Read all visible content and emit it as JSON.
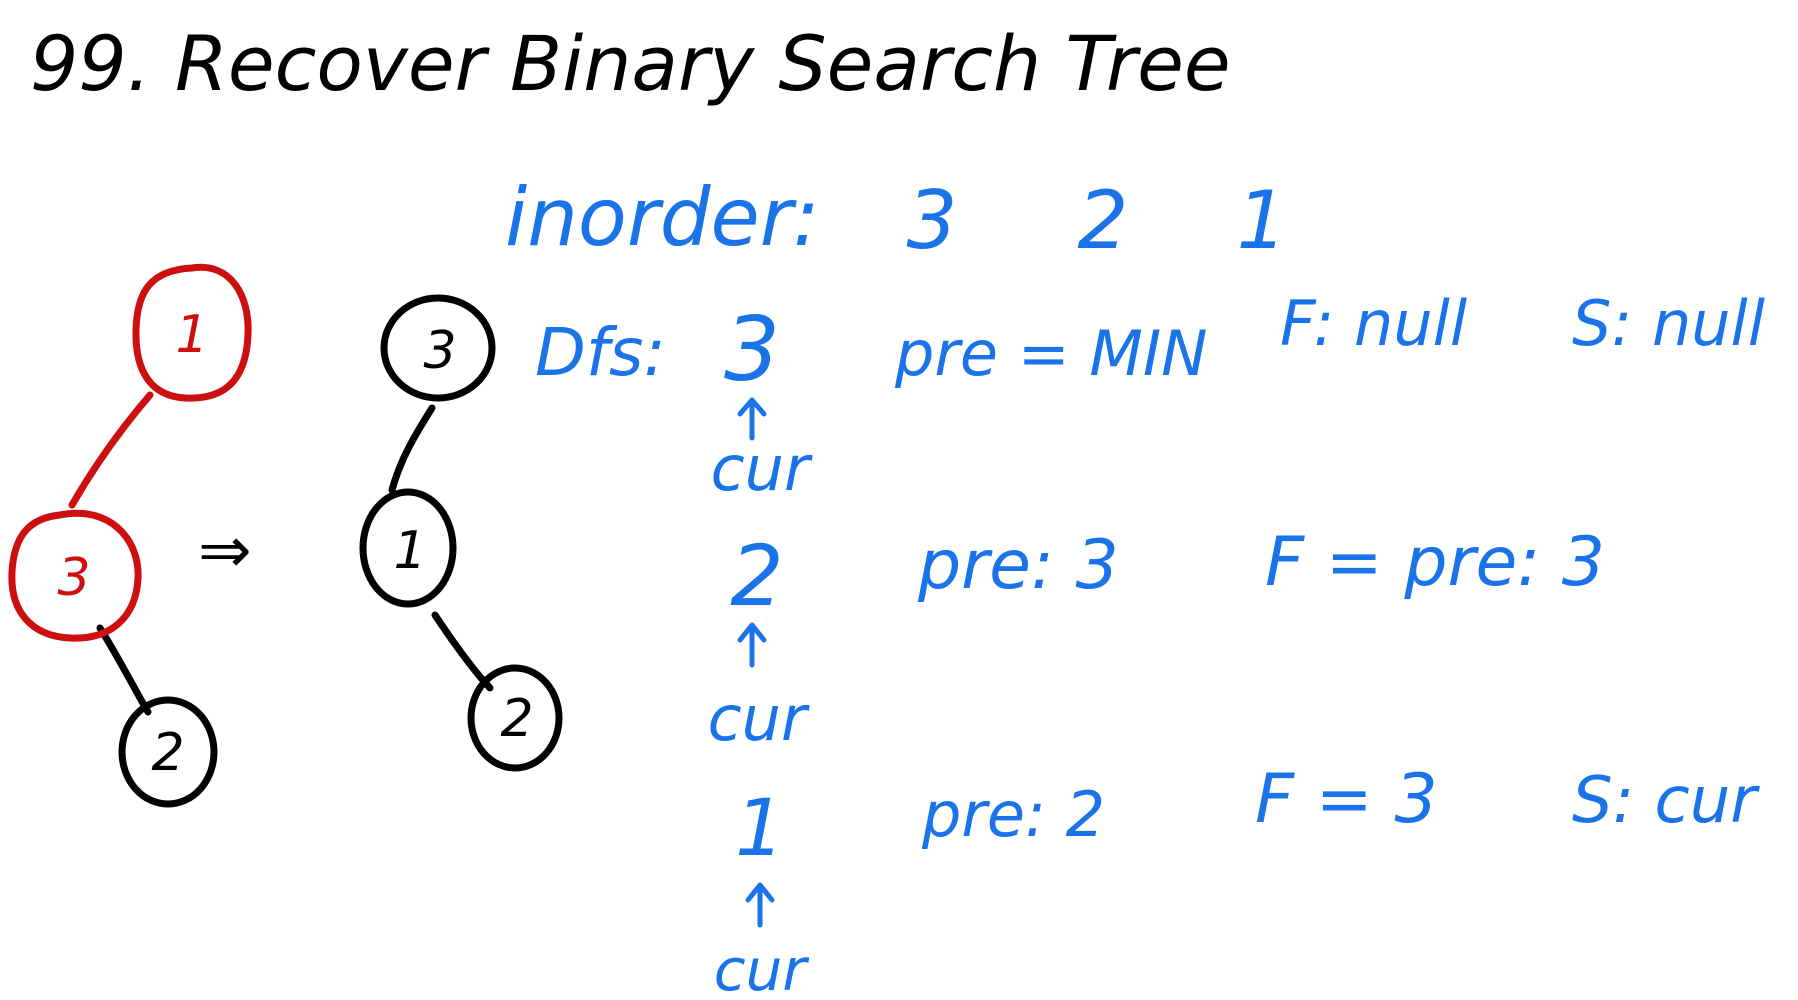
{
  "title": "99. Recover Binary Search Tree",
  "colors": {
    "red": "#cc0f0f",
    "black": "#000000",
    "blue": "#1a73e8"
  },
  "tree_before": {
    "root": "1",
    "left": "3",
    "left_right": "2"
  },
  "transform_arrow": "⇒",
  "tree_after": {
    "root": "3",
    "left": "1",
    "left_right": "2"
  },
  "inorder": {
    "label": "inorder:",
    "values": [
      "3",
      "2",
      "1"
    ]
  },
  "dfs": {
    "label": "Dfs:",
    "steps": [
      {
        "node": "3",
        "cur": "cur",
        "pre": "pre = MIN",
        "f": "F: null",
        "s": "S: null"
      },
      {
        "node": "2",
        "cur": "cur",
        "pre": "pre: 3",
        "f": "F = pre: 3",
        "s": ""
      },
      {
        "node": "1",
        "cur": "cur",
        "pre": "pre: 2",
        "f": "F = 3",
        "s": "S: cur"
      }
    ]
  }
}
